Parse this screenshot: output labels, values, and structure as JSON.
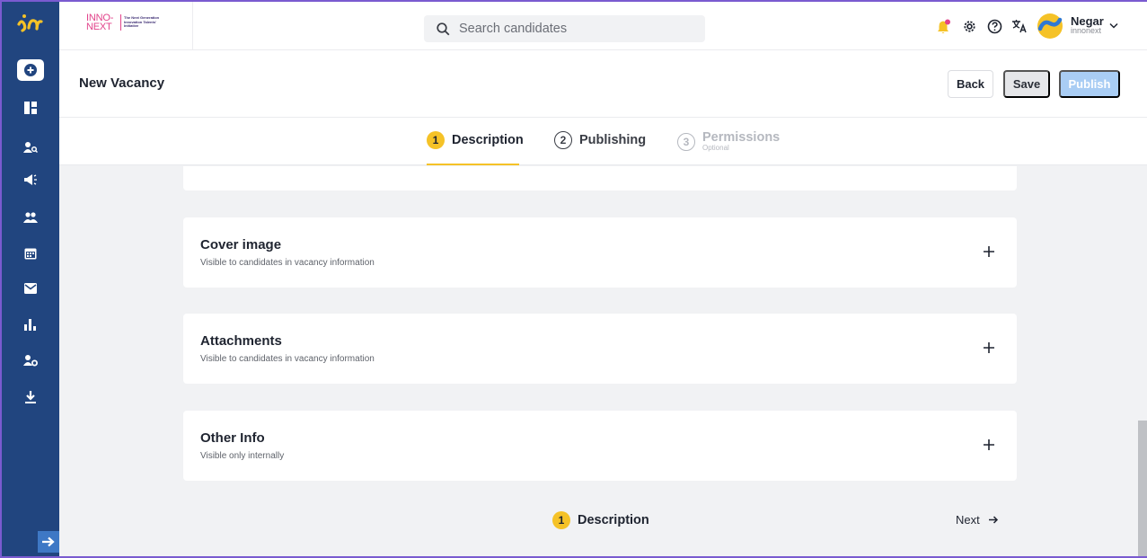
{
  "app": {
    "brand": {
      "name": "INNO-NEXT",
      "tagline": "The Next Generation Innovation Talents' Initiative"
    }
  },
  "search": {
    "placeholder": "Search candidates"
  },
  "user": {
    "name": "Negar",
    "org": "innonext"
  },
  "page": {
    "title": "New Vacancy",
    "buttons": {
      "back": "Back",
      "save": "Save",
      "publish": "Publish"
    }
  },
  "steps": [
    {
      "number": "1",
      "label": "Description",
      "state": "active"
    },
    {
      "number": "2",
      "label": "Publishing",
      "state": "default"
    },
    {
      "number": "3",
      "label": "Permissions",
      "sublabel": "Optional",
      "state": "disabled"
    }
  ],
  "sections": [
    {
      "title": "Cover image",
      "subtitle": "Visible to candidates in vacancy information"
    },
    {
      "title": "Attachments",
      "subtitle": "Visible to candidates in vacancy information"
    },
    {
      "title": "Other Info",
      "subtitle": "Visible only internally"
    }
  ],
  "footer": {
    "current_step": {
      "number": "1",
      "label": "Description"
    },
    "next_label": "Next"
  },
  "icons": {
    "sidebar": [
      "add-icon",
      "dashboard-icon",
      "candidate-search-icon",
      "megaphone-icon",
      "team-icon",
      "calendar-icon",
      "mail-icon",
      "analytics-icon",
      "user-settings-icon",
      "download-icon",
      "expand-sidebar-icon"
    ],
    "topbar": [
      "notification-bell-icon",
      "settings-gear-icon",
      "help-icon",
      "translate-icon"
    ]
  },
  "colors": {
    "sidebar": "#21457f",
    "accent_yellow": "#f5c227",
    "publish_disabled": "#a9cdf4",
    "brand_pink": "#e2428a"
  }
}
